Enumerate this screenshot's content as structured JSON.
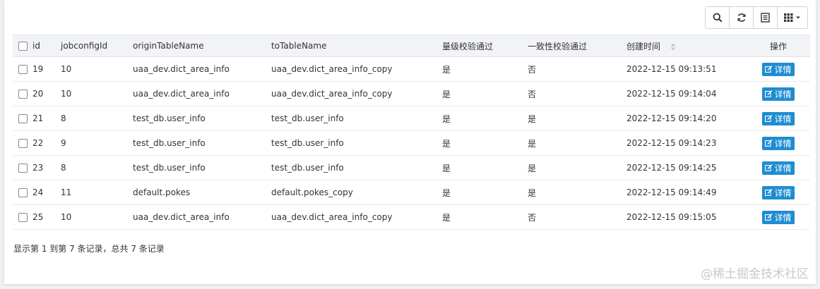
{
  "toolbar": {
    "buttons": [
      {
        "icon": "search-icon"
      },
      {
        "icon": "refresh-icon"
      },
      {
        "icon": "list-icon"
      },
      {
        "icon": "columns-icon"
      }
    ]
  },
  "table": {
    "headers": [
      "id",
      "jobconfigId",
      "originTableName",
      "toTableName",
      "量级校验通过",
      "一致性校验通过",
      "创建时间",
      "操作"
    ],
    "rows": [
      {
        "id": "19",
        "jobconfigId": "10",
        "originTableName": "uaa_dev.dict_area_info",
        "toTableName": "uaa_dev.dict_area_info_copy",
        "volume": "是",
        "consistency": "否",
        "created": "2022-12-15 09:13:51",
        "action": "详情"
      },
      {
        "id": "20",
        "jobconfigId": "10",
        "originTableName": "uaa_dev.dict_area_info",
        "toTableName": "uaa_dev.dict_area_info_copy",
        "volume": "是",
        "consistency": "否",
        "created": "2022-12-15 09:14:04",
        "action": "详情"
      },
      {
        "id": "21",
        "jobconfigId": "8",
        "originTableName": "test_db.user_info",
        "toTableName": "test_db.user_info",
        "volume": "是",
        "consistency": "是",
        "created": "2022-12-15 09:14:20",
        "action": "详情"
      },
      {
        "id": "22",
        "jobconfigId": "9",
        "originTableName": "test_db.user_info",
        "toTableName": "test_db.user_info",
        "volume": "是",
        "consistency": "是",
        "created": "2022-12-15 09:14:23",
        "action": "详情"
      },
      {
        "id": "23",
        "jobconfigId": "8",
        "originTableName": "test_db.user_info",
        "toTableName": "test_db.user_info",
        "volume": "是",
        "consistency": "是",
        "created": "2022-12-15 09:14:25",
        "action": "详情"
      },
      {
        "id": "24",
        "jobconfigId": "11",
        "originTableName": "default.pokes",
        "toTableName": "default.pokes_copy",
        "volume": "是",
        "consistency": "是",
        "created": "2022-12-15 09:14:49",
        "action": "详情"
      },
      {
        "id": "25",
        "jobconfigId": "10",
        "originTableName": "uaa_dev.dict_area_info",
        "toTableName": "uaa_dev.dict_area_info_copy",
        "volume": "是",
        "consistency": "否",
        "created": "2022-12-15 09:15:05",
        "action": "详情"
      }
    ]
  },
  "footer": {
    "summary": "显示第 1 到第 7 条记录，总共 7 条记录"
  },
  "watermark": "@稀土掘金技术社区",
  "colors": {
    "detail_button": "#1f8cd1",
    "header_bg": "#f1f3f6"
  }
}
